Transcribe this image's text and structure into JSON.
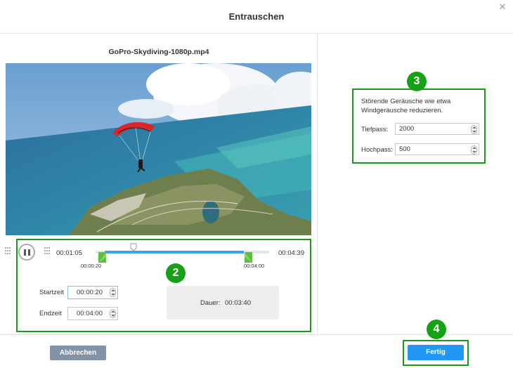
{
  "dialog": {
    "title": "Entrauschen",
    "close_glyph": "✕"
  },
  "video": {
    "filename": "GoPro-Skydiving-1080p.mp4"
  },
  "player": {
    "current_time": "00:01:05",
    "total_time": "00:04:39",
    "trim_start_label": "00:00:20",
    "trim_end_label": "00:04:00",
    "playhead_fraction": 0.233,
    "trim_start_fraction": 0.072,
    "trim_end_fraction": 0.86
  },
  "trim": {
    "start_label": "Startzeit",
    "start_value": "00:00:20",
    "end_label": "Endzeit",
    "end_value": "00:04:00",
    "duration_label": "Dauer:",
    "duration_value": "00:03:40"
  },
  "settings": {
    "description": "Störende Geräusche wie etwa Windgeräusche reduzieren.",
    "lowpass_label": "Tiefpass:",
    "lowpass_value": "2000",
    "highpass_label": "Hochpass:",
    "highpass_value": "500"
  },
  "footer": {
    "cancel_label": "Abbrechen",
    "done_label": "Fertig"
  },
  "callouts": {
    "badge_2": "2",
    "badge_3": "3",
    "badge_4": "4"
  },
  "colors": {
    "accent": "#2196f3",
    "callout_green": "#16a116",
    "selection": "#3aa4e6"
  }
}
